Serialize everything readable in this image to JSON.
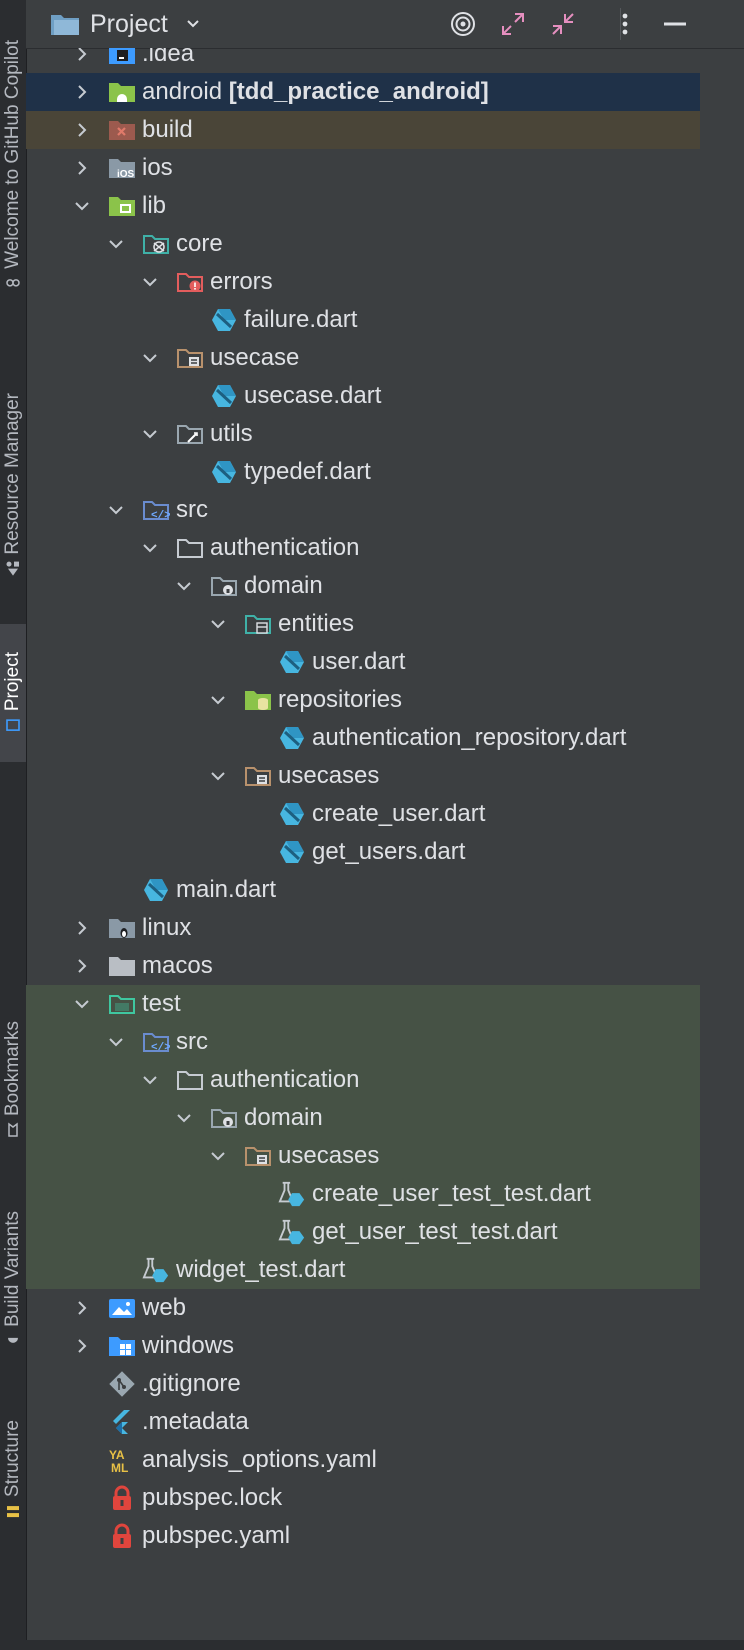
{
  "header": {
    "title": "Project"
  },
  "sidebar": {
    "tabs": [
      {
        "label": "Welcome to GitHub Copilot"
      },
      {
        "label": "Resource Manager"
      },
      {
        "label": "Project"
      },
      {
        "label": "Bookmarks"
      },
      {
        "label": "Build Variants"
      },
      {
        "label": "Structure"
      }
    ]
  },
  "tree": {
    "rows": [
      {
        "label": ".idea",
        "level": 1,
        "chevron": "right",
        "icon": "folder-idea"
      },
      {
        "label": "android ",
        "suffix": "[tdd_practice_android]",
        "level": 1,
        "chevron": "right",
        "icon": "folder-android",
        "highlight": "blue"
      },
      {
        "label": "build",
        "level": 1,
        "chevron": "right",
        "icon": "folder-excluded",
        "highlight": "olive"
      },
      {
        "label": "ios",
        "level": 1,
        "chevron": "right",
        "icon": "folder-ios"
      },
      {
        "label": "lib",
        "level": 1,
        "chevron": "down",
        "icon": "folder-source"
      },
      {
        "label": "core",
        "level": 2,
        "chevron": "down",
        "icon": "folder-core"
      },
      {
        "label": "errors",
        "level": 3,
        "chevron": "down",
        "icon": "folder-errors"
      },
      {
        "label": "failure.dart",
        "level": 4,
        "chevron": "none",
        "icon": "dart-file"
      },
      {
        "label": "usecase",
        "level": 3,
        "chevron": "down",
        "icon": "folder-usecase"
      },
      {
        "label": "usecase.dart",
        "level": 4,
        "chevron": "none",
        "icon": "dart-file"
      },
      {
        "label": "utils",
        "level": 3,
        "chevron": "down",
        "icon": "folder-utils"
      },
      {
        "label": "typedef.dart",
        "level": 4,
        "chevron": "none",
        "icon": "dart-file"
      },
      {
        "label": "src",
        "level": 2,
        "chevron": "down",
        "icon": "folder-src"
      },
      {
        "label": "authentication",
        "level": 3,
        "chevron": "down",
        "icon": "folder-plain"
      },
      {
        "label": "domain",
        "level": 4,
        "chevron": "down",
        "icon": "folder-domain"
      },
      {
        "label": "entities",
        "level": 5,
        "chevron": "down",
        "icon": "folder-entities"
      },
      {
        "label": "user.dart",
        "level": 6,
        "chevron": "none",
        "icon": "dart-file"
      },
      {
        "label": "repositories",
        "level": 5,
        "chevron": "down",
        "icon": "folder-repositories"
      },
      {
        "label": "authentication_repository.dart",
        "level": 6,
        "chevron": "none",
        "icon": "dart-file"
      },
      {
        "label": "usecases",
        "level": 5,
        "chevron": "down",
        "icon": "folder-usecase"
      },
      {
        "label": "create_user.dart",
        "level": 6,
        "chevron": "none",
        "icon": "dart-file"
      },
      {
        "label": "get_users.dart",
        "level": 6,
        "chevron": "none",
        "icon": "dart-file"
      },
      {
        "label": "main.dart",
        "level": 2,
        "chevron": "none",
        "icon": "dart-file"
      },
      {
        "label": "linux",
        "level": 1,
        "chevron": "right",
        "icon": "folder-linux"
      },
      {
        "label": "macos",
        "level": 1,
        "chevron": "right",
        "icon": "folder-macos"
      },
      {
        "label": "test",
        "level": 1,
        "chevron": "down",
        "icon": "folder-test",
        "highlight": "green"
      },
      {
        "label": "src",
        "level": 2,
        "chevron": "down",
        "icon": "folder-src",
        "highlight": "green"
      },
      {
        "label": "authentication",
        "level": 3,
        "chevron": "down",
        "icon": "folder-plain",
        "highlight": "green"
      },
      {
        "label": "domain",
        "level": 4,
        "chevron": "down",
        "icon": "folder-domain",
        "highlight": "green"
      },
      {
        "label": "usecases",
        "level": 5,
        "chevron": "down",
        "icon": "folder-usecase",
        "highlight": "green"
      },
      {
        "label": "create_user_test_test.dart",
        "level": 6,
        "chevron": "none",
        "icon": "dart-test-file",
        "highlight": "green"
      },
      {
        "label": "get_user_test_test.dart",
        "level": 6,
        "chevron": "none",
        "icon": "dart-test-file",
        "highlight": "green"
      },
      {
        "label": "widget_test.dart",
        "level": 2,
        "chevron": "none",
        "icon": "dart-test-file",
        "highlight": "green"
      },
      {
        "label": "web",
        "level": 1,
        "chevron": "right",
        "icon": "folder-web"
      },
      {
        "label": "windows",
        "level": 1,
        "chevron": "right",
        "icon": "folder-windows"
      },
      {
        "label": ".gitignore",
        "level": 1,
        "chevron": "none",
        "icon": "git-file"
      },
      {
        "label": ".metadata",
        "level": 1,
        "chevron": "none",
        "icon": "flutter-file"
      },
      {
        "label": "analysis_options.yaml",
        "level": 1,
        "chevron": "none",
        "icon": "yaml-file"
      },
      {
        "label": "pubspec.lock",
        "level": 1,
        "chevron": "none",
        "icon": "lock-file"
      },
      {
        "label": "pubspec.yaml",
        "level": 1,
        "chevron": "none",
        "icon": "lock-file"
      }
    ]
  },
  "colors": {
    "background": "#3c3f41",
    "sidebar": "#2b2d30",
    "text": "#dfe1e5",
    "selection_blue": "#1f3148",
    "selection_olive": "#4a4538",
    "test_green": "#465245",
    "dart_blue": "#40c4ff",
    "folder_gray": "#9aa7b0"
  }
}
